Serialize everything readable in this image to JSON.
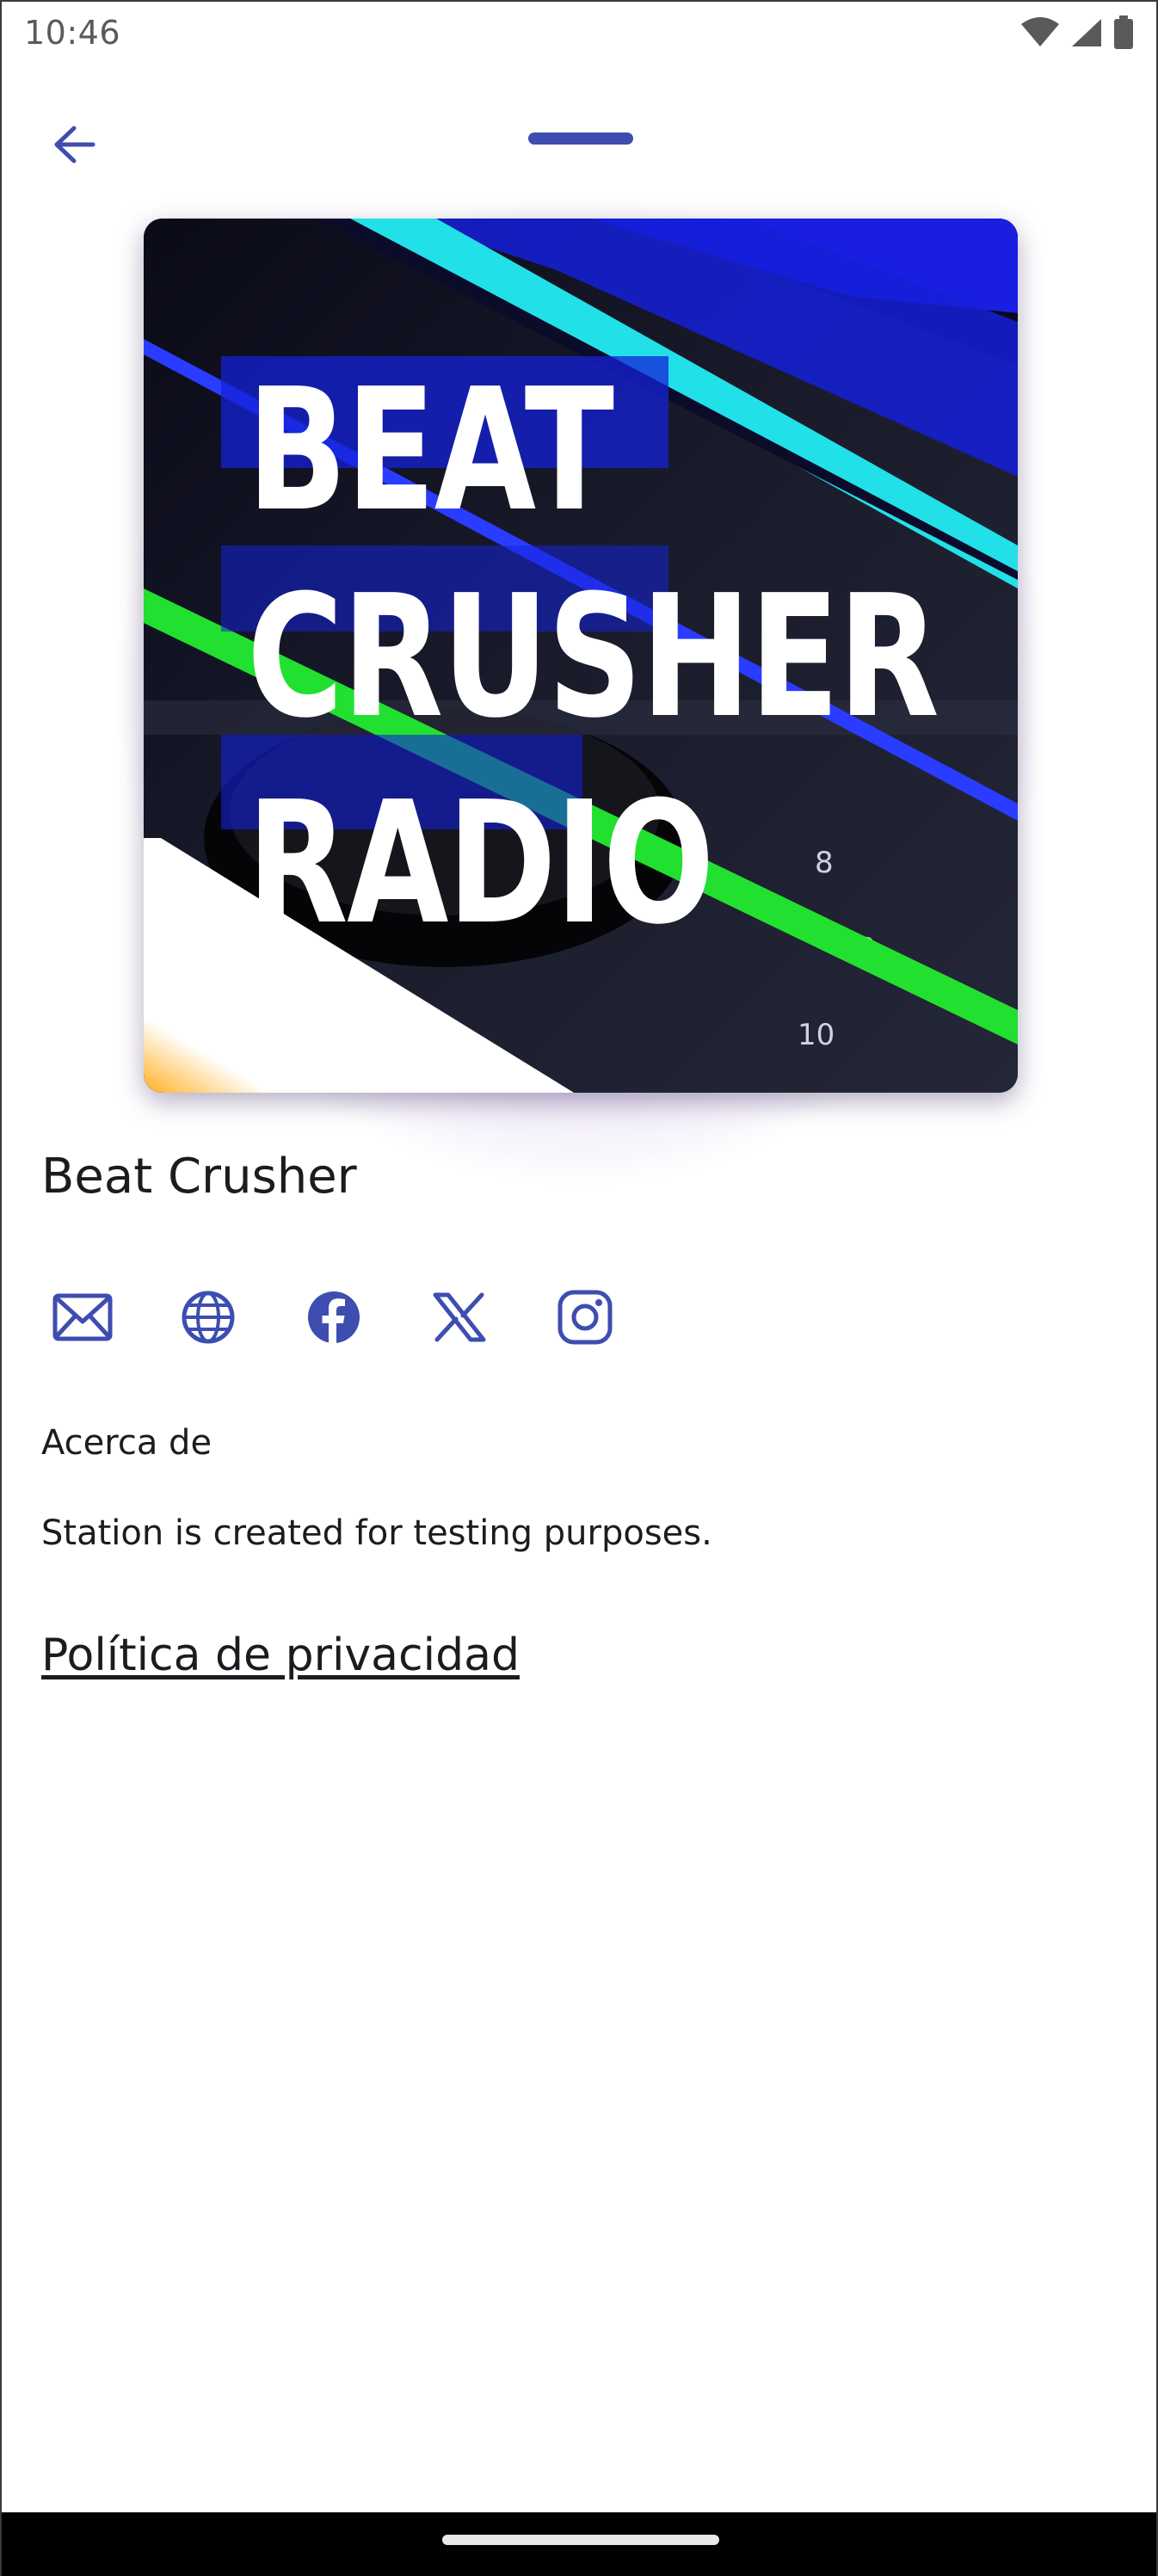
{
  "status_bar": {
    "time": "10:46",
    "icons": [
      "wifi-icon",
      "signal-icon",
      "battery-icon"
    ]
  },
  "header": {
    "back_icon": "arrow-left-icon",
    "handle": "drag-handle"
  },
  "artwork": {
    "lines": [
      "BEAT",
      "CRUSHER",
      "RADIO"
    ]
  },
  "station": {
    "name": "Beat Crusher"
  },
  "social": [
    {
      "icon": "mail-icon"
    },
    {
      "icon": "globe-icon"
    },
    {
      "icon": "facebook-icon"
    },
    {
      "icon": "x-icon"
    },
    {
      "icon": "instagram-icon"
    }
  ],
  "about": {
    "label": "Acerca de",
    "text": "Station is created for testing purposes."
  },
  "privacy": {
    "label": "Política de privacidad"
  },
  "colors": {
    "accent": "#3e4db0",
    "text": "#1c1b1f",
    "glow": "#8a62c8"
  }
}
